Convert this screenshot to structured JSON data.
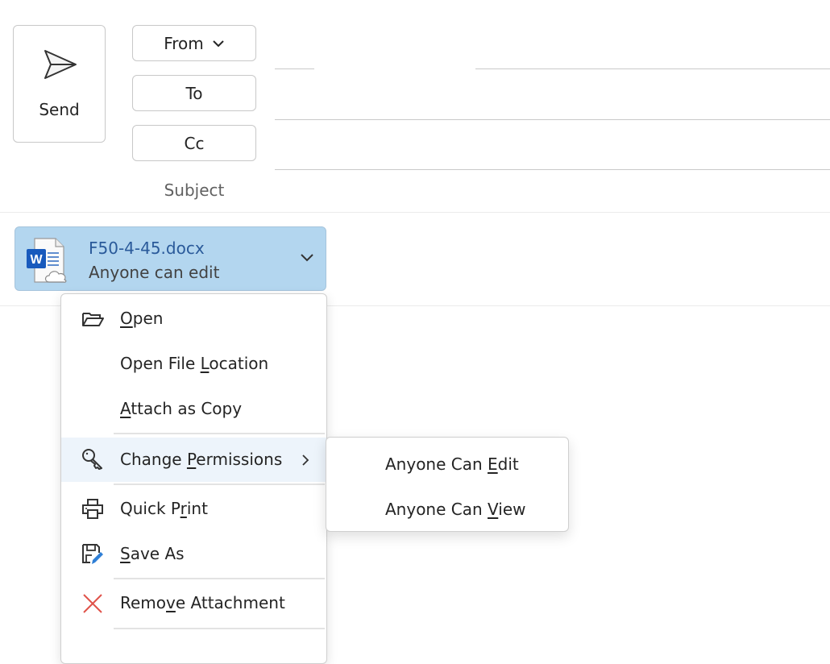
{
  "compose": {
    "send_label": "Send",
    "from_label": "From",
    "to_label": "To",
    "cc_label": "Cc",
    "subject_label": "Subject"
  },
  "attachment": {
    "file_name": "F50-4-45.docx",
    "permission": "Anyone can edit",
    "icon": "word-cloud-file-icon",
    "chip_color": "#b3d6ef"
  },
  "context_menu": {
    "items": [
      {
        "icon": "folder-open-icon",
        "pre": "",
        "key": "O",
        "post": "pen"
      },
      {
        "icon": "",
        "pre": "Open File ",
        "key": "L",
        "post": "ocation"
      },
      {
        "icon": "",
        "pre": "",
        "key": "A",
        "post": "ttach as Copy"
      },
      {
        "icon": "key-icon",
        "pre": "Change ",
        "key": "P",
        "post": "ermissions",
        "has_submenu": true,
        "highlighted": true
      },
      {
        "icon": "printer-icon",
        "pre": "Quick P",
        "key": "r",
        "post": "int"
      },
      {
        "icon": "save-as-icon",
        "pre": "",
        "key": "S",
        "post": "ave As"
      },
      {
        "icon": "close-icon",
        "pre": "Remo",
        "key": "v",
        "post": "e Attachment"
      }
    ]
  },
  "submenu": {
    "items": [
      {
        "pre": "Anyone Can ",
        "key": "E",
        "post": "dit"
      },
      {
        "pre": "Anyone Can ",
        "key": "V",
        "post": "iew"
      }
    ]
  },
  "colors": {
    "highlight": "#edf4fb",
    "remove_red": "#e0524a",
    "save_pen_blue": "#2f7fd6",
    "word_blue": "#185abd"
  }
}
